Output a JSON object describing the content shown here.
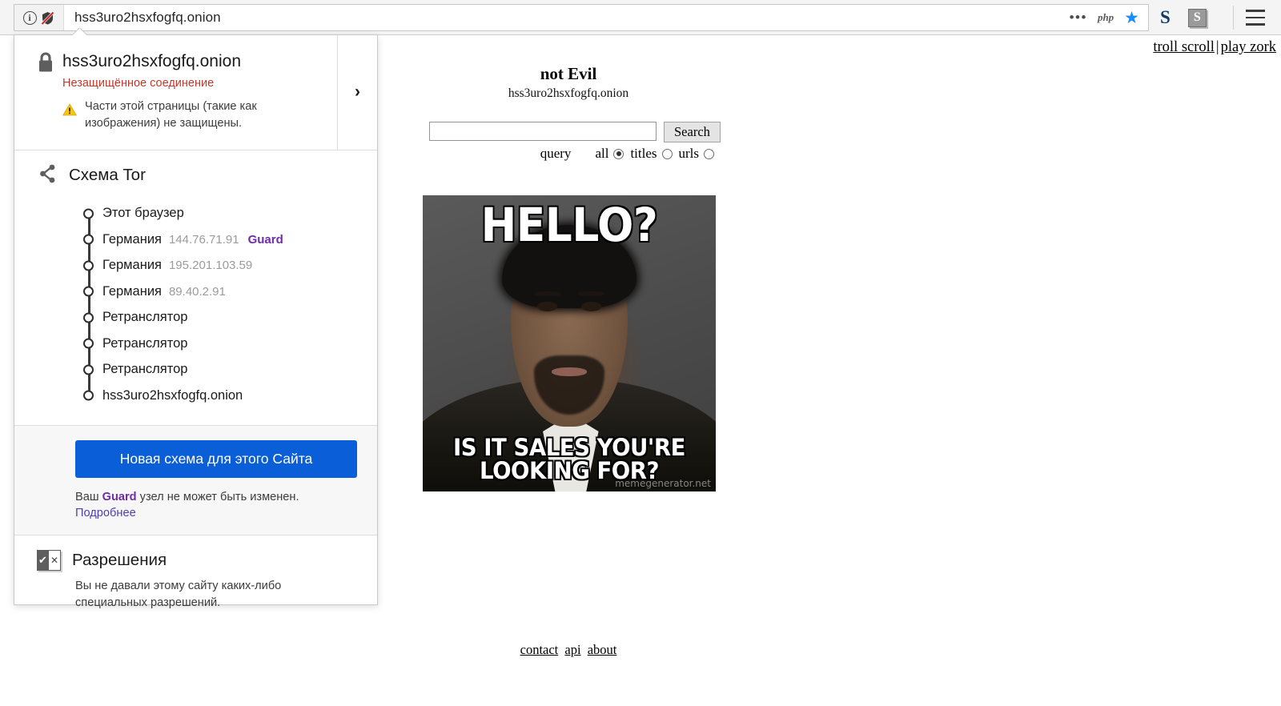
{
  "browser": {
    "url": "hss3uro2hsxfogfq.onion",
    "identity_icons": [
      "info-icon",
      "mixed-content-blocked-icon"
    ],
    "urlbar_right_icons": [
      "more-dots-icon",
      "php-icon",
      "bookmark-star-icon"
    ],
    "extension_icons": [
      "skype-s-icon",
      "s-extension-icon"
    ],
    "menu_icon": "hamburger-menu-icon"
  },
  "identity_panel": {
    "site_host": "hss3uro2hsxfogfq.onion",
    "connection_status": "Незащищённое соединение",
    "mixed_content_warning": "Части этой страницы (такие как изображения) не защищены.",
    "expand_chevron": "›",
    "tor": {
      "title": "Схема Tor",
      "nodes": [
        {
          "label": "Этот браузер",
          "ip": "",
          "role": ""
        },
        {
          "label": "Германия",
          "ip": "144.76.71.91",
          "role": "Guard"
        },
        {
          "label": "Германия",
          "ip": "195.201.103.59",
          "role": ""
        },
        {
          "label": "Германия",
          "ip": "89.40.2.91",
          "role": ""
        },
        {
          "label": "Ретранслятор",
          "ip": "",
          "role": ""
        },
        {
          "label": "Ретранслятор",
          "ip": "",
          "role": ""
        },
        {
          "label": "Ретранслятор",
          "ip": "",
          "role": ""
        },
        {
          "label": "hss3uro2hsxfogfq.onion",
          "ip": "",
          "role": ""
        }
      ]
    },
    "new_circuit": {
      "button_label": "Новая схема для этого Сайта",
      "note_prefix": "Ваш ",
      "note_bold": "Guard",
      "note_suffix": " узел не может быть изменен.",
      "more_link": "Подробнее"
    },
    "permissions": {
      "title": "Разрешения",
      "description": "Вы не давали этому сайту каких-либо специальных разрешений."
    },
    "colors": {
      "insecure_red": "#c0392b",
      "guard_purple": "#6f2da8",
      "button_blue": "#0a5ed7",
      "link_purple": "#4a3fb5"
    }
  },
  "page": {
    "top_links": [
      {
        "label": "troll scroll"
      },
      {
        "label": "play zork"
      }
    ],
    "top_links_separator": "|",
    "title": "not Evil",
    "subtitle": "hss3uro2hsxfogfq.onion",
    "search": {
      "value": "",
      "placeholder": "",
      "button_label": "Search",
      "scope_label": "query",
      "options": [
        {
          "label": "all",
          "checked": true
        },
        {
          "label": "titles",
          "checked": false
        },
        {
          "label": "urls",
          "checked": false
        }
      ]
    },
    "meme": {
      "top_text": "HELLO?",
      "bottom_text": "IS IT SALES YOU'RE LOOKING FOR?",
      "watermark": "memegenerator.net"
    },
    "footer_links": [
      {
        "label": "contact"
      },
      {
        "label": "api"
      },
      {
        "label": "about"
      }
    ]
  }
}
